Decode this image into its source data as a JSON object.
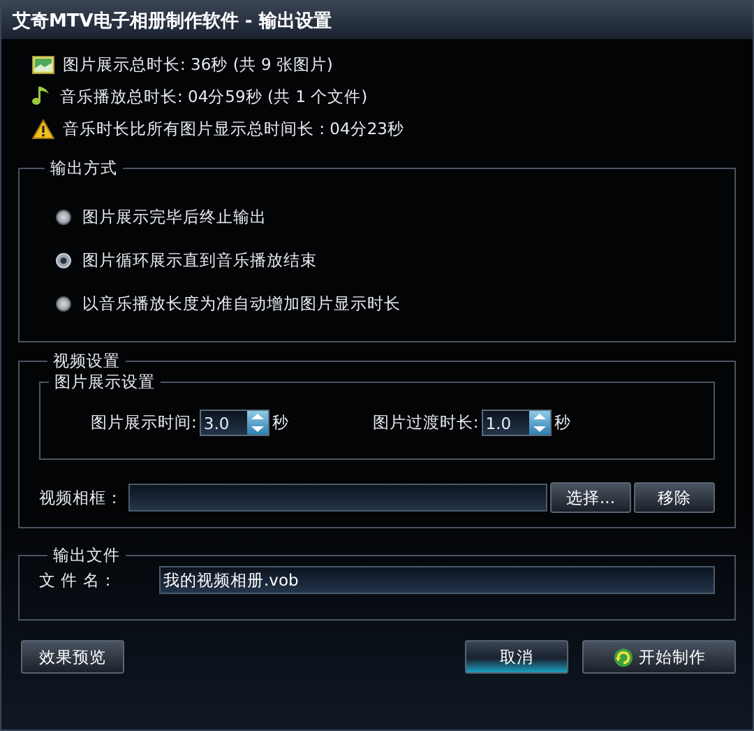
{
  "window": {
    "title": "艾奇MTV电子相册制作软件 - 输出设置"
  },
  "info": [
    {
      "kind": "picture",
      "text": "图片展示总时长: 36秒 (共 9 张图片)"
    },
    {
      "kind": "music",
      "text": "音乐播放总时长: 04分59秒 (共 1 个文件)"
    },
    {
      "kind": "warning",
      "text": "音乐时长比所有图片显示总时间长 : 04分23秒"
    }
  ],
  "output_mode": {
    "title": "输出方式",
    "options": [
      {
        "label": "图片展示完毕后终止输出",
        "selected": false
      },
      {
        "label": "图片循环展示直到音乐播放结束",
        "selected": true
      },
      {
        "label": "以音乐播放长度为准自动增加图片显示时长",
        "selected": false
      }
    ]
  },
  "video_settings": {
    "title": "视频设置",
    "display": {
      "title": "图片展示设置",
      "fields": [
        {
          "label": "图片展示时间:",
          "value": "3.0",
          "unit": "秒"
        },
        {
          "label": "图片过渡时长:",
          "value": "1.0",
          "unit": "秒"
        }
      ]
    },
    "frame": {
      "label": "视频相框：",
      "buttons": [
        "选择...",
        "移除"
      ]
    }
  },
  "output_file": {
    "title": "输出文件",
    "label": "文 件 名：",
    "value": "我的视频相册.vob"
  },
  "buttons": {
    "preview": "效果预览",
    "cancel": "取消",
    "start": "开始制作"
  }
}
